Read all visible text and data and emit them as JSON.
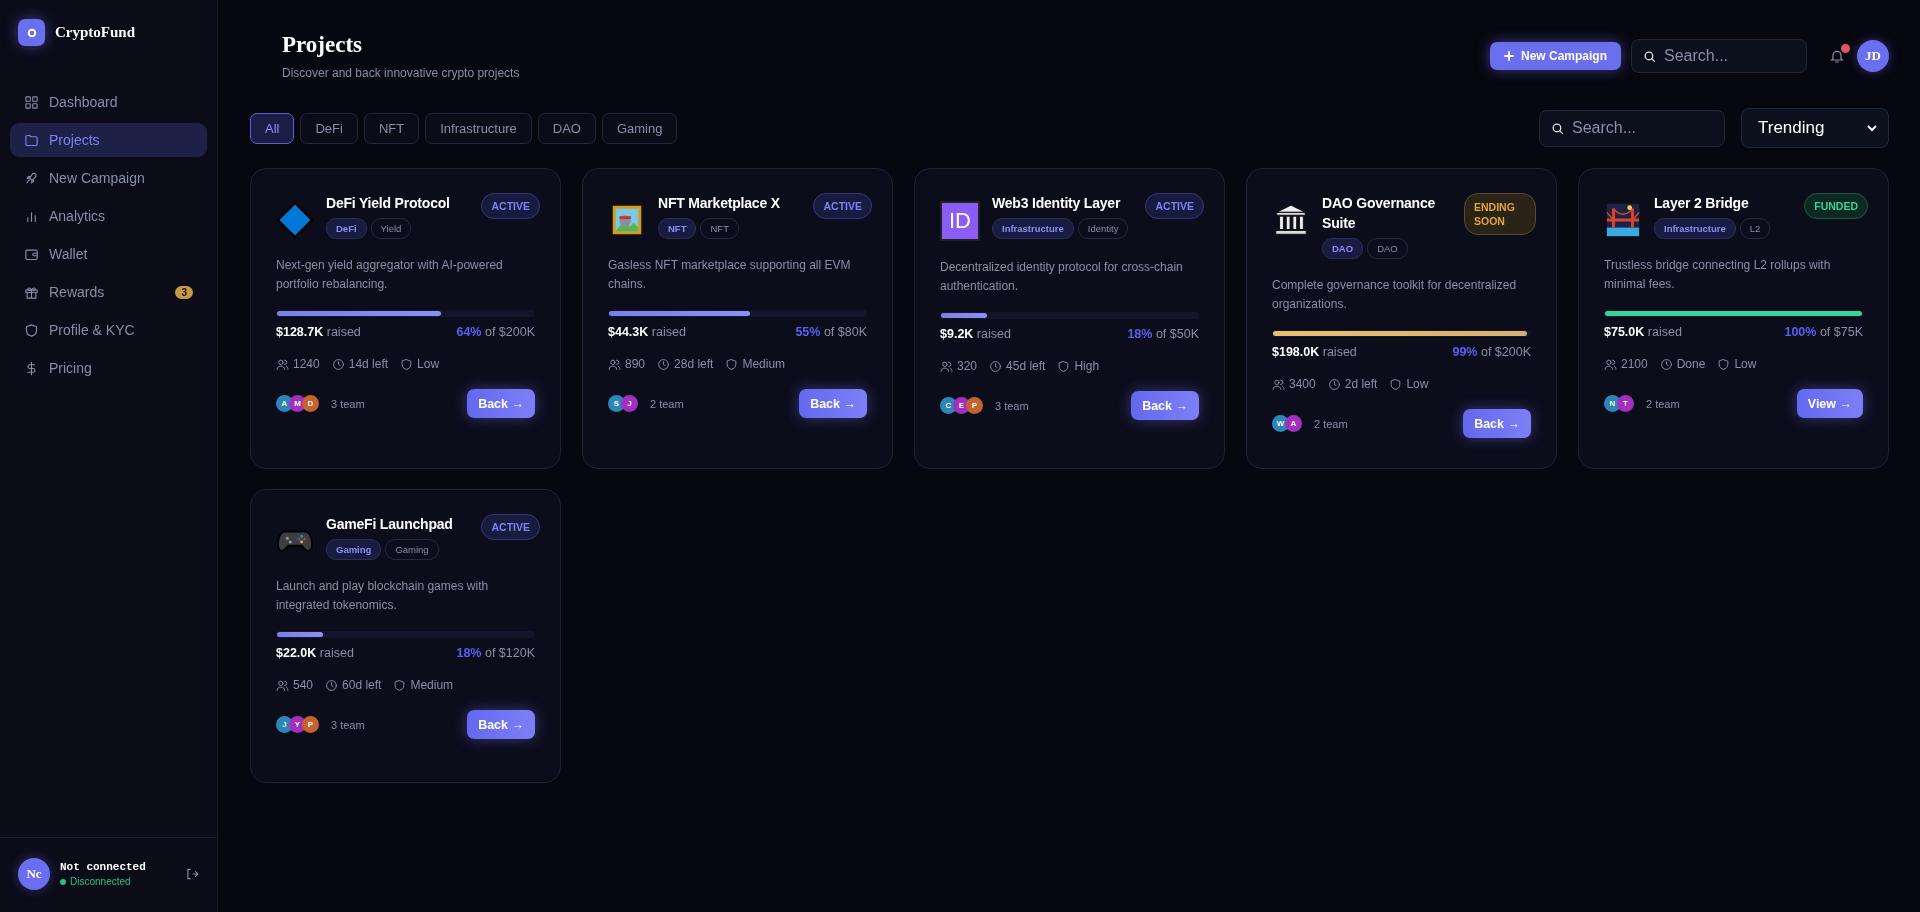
{
  "sidebar": {
    "brand": "CryptoFund",
    "items": [
      {
        "label": "Dashboard",
        "selected": false
      },
      {
        "label": "Projects",
        "selected": true
      },
      {
        "label": "New Campaign",
        "selected": false
      },
      {
        "label": "Analytics",
        "selected": false
      },
      {
        "label": "Wallet",
        "selected": false
      },
      {
        "label": "Rewards",
        "selected": false,
        "badge": "3"
      },
      {
        "label": "Profile & KYC",
        "selected": false
      },
      {
        "label": "Pricing",
        "selected": false
      }
    ],
    "account": {
      "initials": "Nc",
      "name": "Not connected",
      "status": "Disconnected"
    }
  },
  "header": {
    "title": "Projects",
    "subtitle": "Discover and back innovative crypto projects",
    "new_button": "New Campaign",
    "search": {
      "placeholder": "Search..."
    },
    "unread": true,
    "avatar": "JD"
  },
  "filters": {
    "chips": [
      {
        "label": "All",
        "selected": true
      },
      {
        "label": "DeFi",
        "selected": false
      },
      {
        "label": "NFT",
        "selected": false
      },
      {
        "label": "Infrastructure",
        "selected": false
      },
      {
        "label": "DAO",
        "selected": false
      },
      {
        "label": "Gaming",
        "selected": false
      }
    ],
    "search": {
      "placeholder": "Search..."
    },
    "sort": "Trending"
  },
  "projects": [
    {
      "name": "DeFi Yield Protocol",
      "status": {
        "label": "ACTIVE",
        "kind": "active"
      },
      "tags": [
        {
          "label": "DeFi",
          "kind": "category"
        },
        {
          "label": "Yield",
          "kind": "plain"
        }
      ],
      "description": "Next-gen yield aggregator with AI-powered portfolio rebalancing.",
      "level": 0.64,
      "raised": "$128.7K",
      "raised_label": "raised",
      "percent": "64%",
      "goal": "of $200K",
      "backers": "1240",
      "time": "14d left",
      "risk": "Low",
      "team": [
        {
          "initial": "A",
          "color": "#2b87b8"
        },
        {
          "initial": "M",
          "color": "#a22fc0"
        },
        {
          "initial": "D",
          "color": "#c4632e"
        }
      ],
      "team_label": "3 team",
      "action": "Back →"
    },
    {
      "name": "NFT Marketplace X",
      "status": {
        "label": "ACTIVE",
        "kind": "active"
      },
      "tags": [
        {
          "label": "NFT",
          "kind": "category"
        },
        {
          "label": "NFT",
          "kind": "plain"
        }
      ],
      "description": "Gasless NFT marketplace supporting all EVM chains.",
      "level": 0.55,
      "raised": "$44.3K",
      "raised_label": "raised",
      "percent": "55%",
      "goal": "of $80K",
      "backers": "890",
      "time": "28d left",
      "risk": "Medium",
      "team": [
        {
          "initial": "S",
          "color": "#2b87b8"
        },
        {
          "initial": "J",
          "color": "#a22fc0"
        }
      ],
      "team_label": "2 team",
      "action": "Back →"
    },
    {
      "logo_text": "ID",
      "name": "Web3 Identity Layer",
      "status": {
        "label": "ACTIVE",
        "kind": "active"
      },
      "tags": [
        {
          "label": "Infrastructure",
          "kind": "category"
        },
        {
          "label": "Identity",
          "kind": "plain"
        }
      ],
      "description": "Decentralized identity protocol for cross-chain authentication.",
      "level": 0.18,
      "raised": "$9.2K",
      "raised_label": "raised",
      "percent": "18%",
      "goal": "of $50K",
      "backers": "320",
      "time": "45d left",
      "risk": "High",
      "team": [
        {
          "initial": "C",
          "color": "#2b87b8"
        },
        {
          "initial": "E",
          "color": "#a22fc0"
        },
        {
          "initial": "P",
          "color": "#c4632e"
        }
      ],
      "team_label": "3 team",
      "action": "Back →"
    },
    {
      "name": "DAO Governance Suite",
      "status": {
        "label": "ENDING SOON",
        "kind": "ending"
      },
      "tags": [
        {
          "label": "DAO",
          "kind": "category"
        },
        {
          "label": "DAO",
          "kind": "plain"
        }
      ],
      "description": "Complete governance toolkit for decentralized organizations.",
      "level": 0.99,
      "raised": "$198.0K",
      "raised_label": "raised",
      "percent": "99%",
      "goal": "of $200K",
      "backers": "3400",
      "time": "2d left",
      "risk": "Low",
      "team": [
        {
          "initial": "W",
          "color": "#2b87b8"
        },
        {
          "initial": "A",
          "color": "#a22fc0"
        }
      ],
      "team_label": "2 team",
      "action": "Back →"
    },
    {
      "name": "Layer 2 Bridge",
      "status": {
        "label": "FUNDED",
        "kind": "funded"
      },
      "tags": [
        {
          "label": "Infrastructure",
          "kind": "category"
        },
        {
          "label": "L2",
          "kind": "plain"
        }
      ],
      "description": "Trustless bridge connecting L2 rollups with minimal fees.",
      "level": 1,
      "raised": "$75.0K",
      "raised_label": "raised",
      "percent": "100%",
      "goal": "of $75K",
      "backers": "2100",
      "time": "Done",
      "risk": "Low",
      "team": [
        {
          "initial": "N",
          "color": "#2b87b8"
        },
        {
          "initial": "T",
          "color": "#a22fc0"
        }
      ],
      "team_label": "2 team",
      "action": "View →"
    },
    {
      "name": "GameFi Launchpad",
      "status": {
        "label": "ACTIVE",
        "kind": "active"
      },
      "tags": [
        {
          "label": "Gaming",
          "kind": "category"
        },
        {
          "label": "Gaming",
          "kind": "plain"
        }
      ],
      "description": "Launch and play blockchain games with integrated tokenomics.",
      "level": 0.18,
      "raised": "$22.0K",
      "raised_label": "raised",
      "percent": "18%",
      "goal": "of $120K",
      "backers": "540",
      "time": "60d left",
      "risk": "Medium",
      "team": [
        {
          "initial": "J",
          "color": "#2b87b8"
        },
        {
          "initial": "Y",
          "color": "#a22fc0"
        },
        {
          "initial": "P",
          "color": "#c4632e"
        }
      ],
      "team_label": "3 team",
      "action": "Back →"
    }
  ]
}
